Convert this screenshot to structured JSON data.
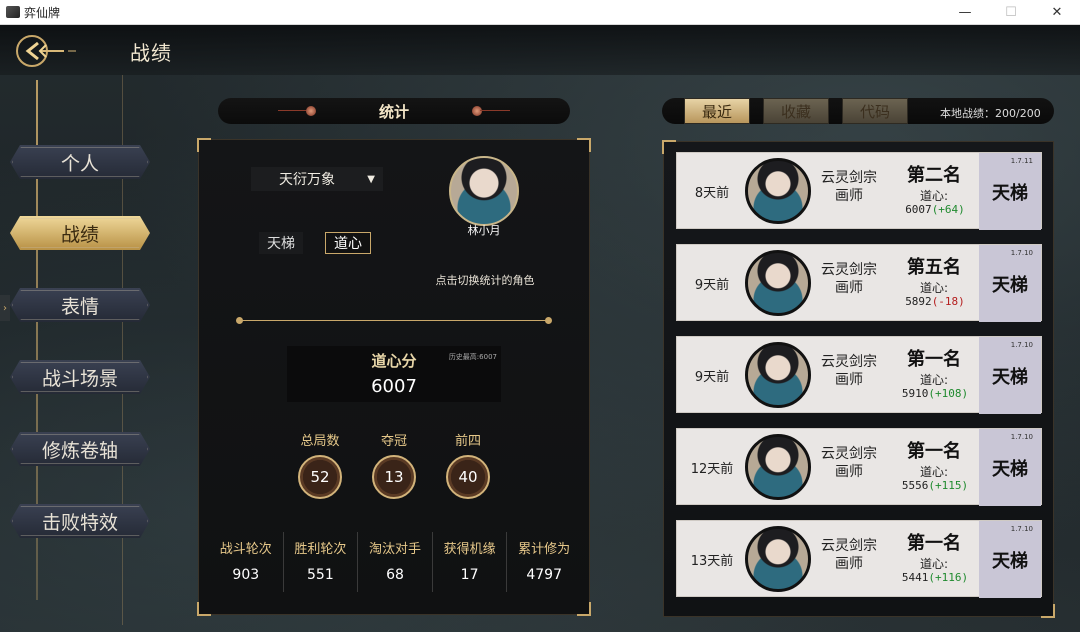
{
  "window": {
    "title": "弈仙牌",
    "minimize": "—",
    "maximize": "☐",
    "close": "✕"
  },
  "header": {
    "title": "战绩",
    "back_icon": "back-arrow-icon"
  },
  "sidebar": {
    "items": [
      {
        "label": "个人",
        "active": false
      },
      {
        "label": "战绩",
        "active": true
      },
      {
        "label": "表情",
        "active": false
      },
      {
        "label": "战斗场景",
        "active": false
      },
      {
        "label": "修炼卷轴",
        "active": false
      },
      {
        "label": "击败特效",
        "active": false
      }
    ],
    "handle": "›"
  },
  "stats": {
    "title": "统计",
    "sect_select": "天衍万象",
    "mode_tabs": [
      {
        "label": "天梯",
        "selected": false
      },
      {
        "label": "道心",
        "selected": true
      }
    ],
    "character_name": "林小月",
    "switch_hint": "点击切换统计的角色",
    "score_label": "道心分",
    "score_best": "历史最高:6007",
    "score_value": "6007",
    "circles": [
      {
        "label": "总局数",
        "value": "52"
      },
      {
        "label": "夺冠",
        "value": "13"
      },
      {
        "label": "前四",
        "value": "40"
      }
    ],
    "bottom": [
      {
        "label": "战斗轮次",
        "value": "903"
      },
      {
        "label": "胜利轮次",
        "value": "551"
      },
      {
        "label": "淘汰对手",
        "value": "68"
      },
      {
        "label": "获得机缘",
        "value": "17"
      },
      {
        "label": "累计修为",
        "value": "4797"
      }
    ]
  },
  "filters": {
    "buttons": [
      {
        "label": "最近",
        "active": true
      },
      {
        "label": "收藏",
        "active": false
      },
      {
        "label": "代码",
        "active": false
      }
    ],
    "local_count": "本地战绩：200/200"
  },
  "records": [
    {
      "days": "8天前",
      "sect": "云灵剑宗",
      "role": "画师",
      "rank": "第二名",
      "dao_label": "道心:",
      "score": "6007",
      "delta": "(+64)",
      "delta_sign": "pos",
      "mode": "天梯",
      "version": "1.7.11"
    },
    {
      "days": "9天前",
      "sect": "云灵剑宗",
      "role": "画师",
      "rank": "第五名",
      "dao_label": "道心:",
      "score": "5892",
      "delta": "(-18)",
      "delta_sign": "neg",
      "mode": "天梯",
      "version": "1.7.10"
    },
    {
      "days": "9天前",
      "sect": "云灵剑宗",
      "role": "画师",
      "rank": "第一名",
      "dao_label": "道心:",
      "score": "5910",
      "delta": "(+108)",
      "delta_sign": "pos",
      "mode": "天梯",
      "version": "1.7.10"
    },
    {
      "days": "12天前",
      "sect": "云灵剑宗",
      "role": "画师",
      "rank": "第一名",
      "dao_label": "道心:",
      "score": "5556",
      "delta": "(+115)",
      "delta_sign": "pos",
      "mode": "天梯",
      "version": "1.7.10"
    },
    {
      "days": "13天前",
      "sect": "云灵剑宗",
      "role": "画师",
      "rank": "第一名",
      "dao_label": "道心:",
      "score": "5441",
      "delta": "(+116)",
      "delta_sign": "pos",
      "mode": "天梯",
      "version": "1.7.10"
    }
  ]
}
